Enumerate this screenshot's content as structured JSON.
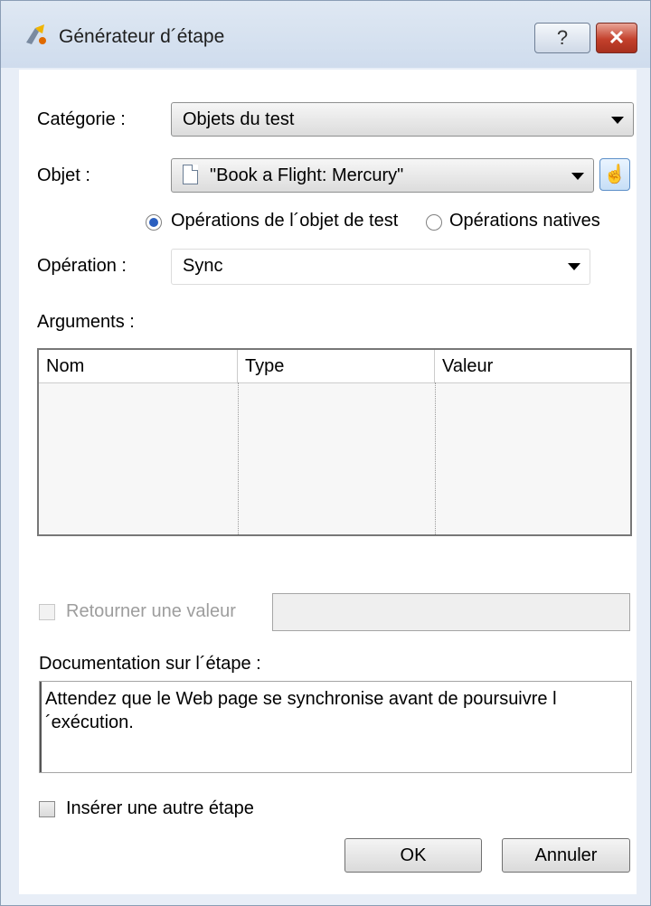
{
  "window": {
    "title": "Générateur d´étape",
    "help_label": "?",
    "close_label": "✕"
  },
  "category": {
    "label": "Catégorie :",
    "value": "Objets du test"
  },
  "object": {
    "label": "Objet :",
    "value": "\"Book a Flight: Mercury\"",
    "select_icon": "pointing-hand-icon"
  },
  "operation_type": {
    "options": [
      {
        "label": "Opérations de l´objet de test",
        "selected": true
      },
      {
        "label": "Opérations natives",
        "selected": false
      }
    ]
  },
  "operation": {
    "label": "Opération :",
    "value": "Sync"
  },
  "arguments": {
    "label": "Arguments :",
    "columns": [
      "Nom",
      "Type",
      "Valeur"
    ],
    "rows": []
  },
  "return_value": {
    "label": "Retourner une valeur",
    "checked": false,
    "enabled": false,
    "value": ""
  },
  "documentation": {
    "label": "Documentation sur l´étape :",
    "text": "Attendez que le Web page se synchronise avant de poursuivre l´exécution."
  },
  "insert_another": {
    "label": "Insérer une autre étape",
    "checked": false
  },
  "buttons": {
    "ok": "OK",
    "cancel": "Annuler"
  },
  "colors": {
    "accent": "#2a5fbf",
    "close": "#c3402c"
  }
}
